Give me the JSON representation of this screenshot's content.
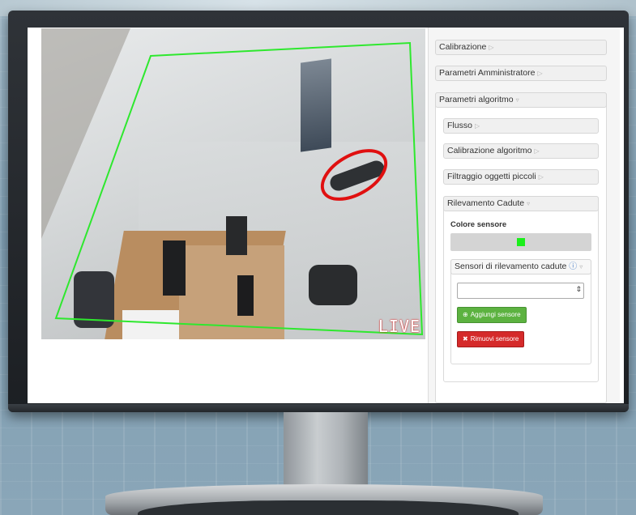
{
  "camera": {
    "overlay_text": "LIVE",
    "zone_color": "#2ee82e",
    "detection_color": "#e01010"
  },
  "panel": {
    "sections": {
      "calibrazione": "Calibrazione",
      "parametri_amministratore": "Parametri Amministratore",
      "parametri_algoritmo": "Parametri algoritmo"
    },
    "algoritmo": {
      "flusso": "Flusso",
      "calibrazione_algoritmo": "Calibrazione algoritmo",
      "filtraggio": "Filtraggio oggetti piccoli",
      "rilevamento_cadute": "Rilevamento Cadute"
    },
    "rilevamento": {
      "colore_label": "Colore sensore",
      "colore_value": "#1bef1b",
      "sensori_label": "Sensori di rilevamento cadute",
      "select_value": "",
      "add_button": "Aggiungi sensore",
      "remove_button": "Rimuovi sensore"
    }
  },
  "icons": {
    "collapsed": "triangle-right-icon",
    "expanded": "triangle-down-icon",
    "info": "info-icon",
    "plus": "plus-circle-icon",
    "close": "close-icon"
  }
}
